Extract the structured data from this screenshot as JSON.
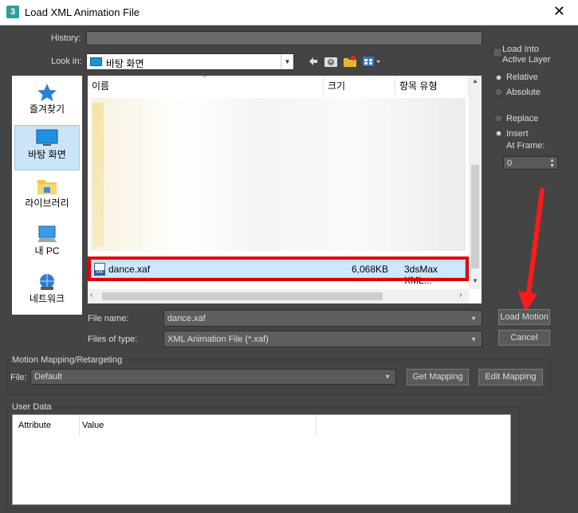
{
  "window": {
    "app_icon": "3",
    "title": "Load XML Animation File",
    "close_glyph": "✕"
  },
  "history": {
    "label": "History:"
  },
  "look_in": {
    "label": "Look in:",
    "value": "바탕 화면"
  },
  "places": [
    {
      "label": "즐겨찾기",
      "icon": "star-icon"
    },
    {
      "label": "바탕 화면",
      "icon": "desktop-icon"
    },
    {
      "label": "라이브러리",
      "icon": "library-icon"
    },
    {
      "label": "내 PC",
      "icon": "pc-icon"
    },
    {
      "label": "네트워크",
      "icon": "network-icon"
    }
  ],
  "columns": {
    "name": "이름",
    "size": "크기",
    "type": "항목 유형"
  },
  "selected_file": {
    "icon_text": "XAF",
    "name": "dance.xaf",
    "size": "6,068KB",
    "type": "3dsMax XML..."
  },
  "file_name": {
    "label": "File name:",
    "value": "dance.xaf"
  },
  "files_of_type": {
    "label": "Files of type:",
    "value": "XML Animation File (*.xaf)"
  },
  "options": {
    "load_into_active_layer": "Load Into Active Layer",
    "relative": "Relative",
    "absolute": "Absolute",
    "replace": "Replace",
    "insert": "Insert",
    "at_frame": "At Frame:",
    "frame_value": "0"
  },
  "buttons": {
    "load_motion": "Load Motion",
    "cancel": "Cancel",
    "get_mapping": "Get Mapping",
    "edit_mapping": "Edit Mapping"
  },
  "mapping": {
    "group_title": "Motion Mapping/Retargeting",
    "file_label": "File:",
    "file_value": "Default"
  },
  "user_data": {
    "group_title": "User Data",
    "col_attribute": "Attribute",
    "col_value": "Value"
  },
  "colors": {
    "highlight_border": "#e00000",
    "arrow": "#ff1a1a",
    "selection": "#cce8ff"
  }
}
